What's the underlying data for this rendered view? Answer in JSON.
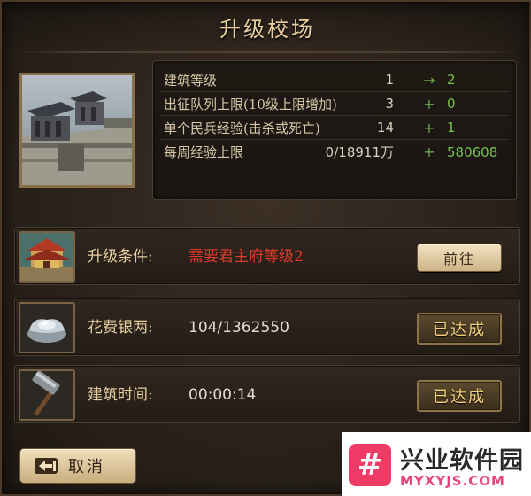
{
  "window": {
    "title": "升级校场"
  },
  "stats": [
    {
      "label": "建筑等级",
      "current": "1",
      "op": "→",
      "next": "2"
    },
    {
      "label": "出征队列上限(10级上限增加)",
      "current": "3",
      "op": "+",
      "next": "0"
    },
    {
      "label": "单个民兵经验(击杀或死亡)",
      "current": "14",
      "op": "+",
      "next": "1"
    },
    {
      "label": "每周经验上限",
      "current": "0/18911万",
      "op": "+",
      "next": "580608"
    }
  ],
  "requirements": [
    {
      "label": "升级条件:",
      "value": "需要君主府等级2",
      "action": "前往",
      "icon": "palace-icon"
    },
    {
      "label": "花费银两:",
      "value": "104/1362550",
      "status": "已达成",
      "icon": "silver-ingot-icon"
    },
    {
      "label": "建筑时间:",
      "value": "00:00:14",
      "status": "已达成",
      "icon": "hammer-icon"
    }
  ],
  "footer": {
    "cancel_label": "取消"
  },
  "watermark": {
    "logo_text": "#",
    "name": "兴业软件园",
    "url": "MYXYJS.COM"
  },
  "colors": {
    "accent_green": "#74c34d",
    "warning_red": "#e03a2a",
    "gold_text": "#f0cf7a",
    "brand_pink": "#ef3c67"
  }
}
